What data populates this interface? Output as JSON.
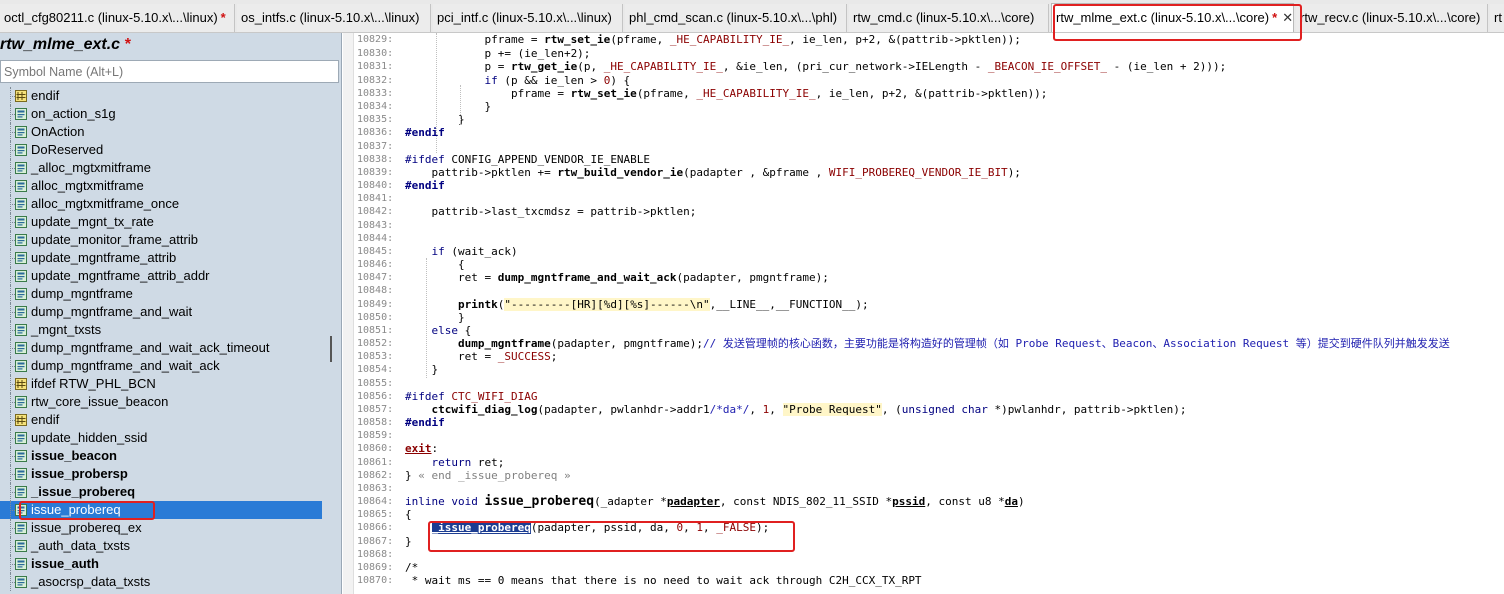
{
  "tabs": [
    {
      "label": "octl_cfg80211.c (linux-5.10.x\\...\\linux)",
      "modified": true,
      "active": false
    },
    {
      "label": "os_intfs.c (linux-5.10.x\\...\\linux)",
      "modified": false,
      "active": false
    },
    {
      "label": "pci_intf.c (linux-5.10.x\\...\\linux)",
      "modified": false,
      "active": false
    },
    {
      "label": "phl_cmd_scan.c (linux-5.10.x\\...\\phl)",
      "modified": false,
      "active": false
    },
    {
      "label": "rtw_cmd.c (linux-5.10.x\\...\\core)",
      "modified": false,
      "active": false
    },
    {
      "label": "rtw_mlme_ext.c (linux-5.10.x\\...\\core)",
      "modified": true,
      "active": true
    },
    {
      "label": "rtw_recv.c (linux-5.10.x\\...\\core)",
      "modified": false,
      "active": false
    },
    {
      "label": "rt",
      "modified": false,
      "active": false
    }
  ],
  "tab_modified_marker": "*",
  "tab_close_glyph": "✕",
  "left": {
    "file_title": "rtw_mlme_ext.c",
    "file_modified": "*",
    "search_placeholder": "Symbol Name (Alt+L)",
    "symbols": [
      {
        "name": "endif",
        "kind": "pp",
        "bold": false
      },
      {
        "name": "on_action_s1g",
        "kind": "func",
        "bold": false
      },
      {
        "name": "OnAction",
        "kind": "func",
        "bold": false
      },
      {
        "name": "DoReserved",
        "kind": "func",
        "bold": false
      },
      {
        "name": "_alloc_mgtxmitframe",
        "kind": "func",
        "bold": false
      },
      {
        "name": "alloc_mgtxmitframe",
        "kind": "func",
        "bold": false
      },
      {
        "name": "alloc_mgtxmitframe_once",
        "kind": "func",
        "bold": false
      },
      {
        "name": "update_mgnt_tx_rate",
        "kind": "func",
        "bold": false
      },
      {
        "name": "update_monitor_frame_attrib",
        "kind": "func",
        "bold": false
      },
      {
        "name": "update_mgntframe_attrib",
        "kind": "func",
        "bold": false
      },
      {
        "name": "update_mgntframe_attrib_addr",
        "kind": "func",
        "bold": false
      },
      {
        "name": "dump_mgntframe",
        "kind": "func",
        "bold": false
      },
      {
        "name": "dump_mgntframe_and_wait",
        "kind": "func",
        "bold": false
      },
      {
        "name": "_mgnt_txsts",
        "kind": "func",
        "bold": false
      },
      {
        "name": "dump_mgntframe_and_wait_ack_timeout",
        "kind": "func",
        "bold": false
      },
      {
        "name": "dump_mgntframe_and_wait_ack",
        "kind": "func",
        "bold": false
      },
      {
        "name": "ifdef RTW_PHL_BCN",
        "kind": "pp",
        "bold": false
      },
      {
        "name": "rtw_core_issue_beacon",
        "kind": "func",
        "bold": false
      },
      {
        "name": "endif",
        "kind": "pp",
        "bold": false
      },
      {
        "name": "update_hidden_ssid",
        "kind": "func",
        "bold": false
      },
      {
        "name": "issue_beacon",
        "kind": "func",
        "bold": true
      },
      {
        "name": "issue_probersp",
        "kind": "func",
        "bold": true
      },
      {
        "name": "_issue_probereq",
        "kind": "func",
        "bold": true
      },
      {
        "name": "issue_probereq",
        "kind": "func",
        "bold": false,
        "selected": true
      },
      {
        "name": "issue_probereq_ex",
        "kind": "func",
        "bold": false
      },
      {
        "name": "_auth_data_txsts",
        "kind": "func",
        "bold": false
      },
      {
        "name": "issue_auth",
        "kind": "func",
        "bold": true
      },
      {
        "name": "_asocrsp_data_txsts",
        "kind": "func",
        "bold": false
      }
    ]
  },
  "editor": {
    "line_numbers": [
      "10829:",
      "10830:",
      "10831:",
      "10832:",
      "10833:",
      "10834:",
      "10835:",
      "10836:",
      "10837:",
      "10838:",
      "10839:",
      "10840:",
      "10841:",
      "10842:",
      "10843:",
      "10844:",
      "10845:",
      "10846:",
      "10847:",
      "10848:",
      "10849:",
      "10850:",
      "10851:",
      "10852:",
      "10853:",
      "10854:",
      "10855:",
      "10856:",
      "10857:",
      "10858:",
      "10859:",
      "10860:",
      "10861:",
      "10862:",
      "10863:",
      "10864:",
      "10865:",
      "10866:",
      "10867:",
      "10868:",
      "10869:",
      "10870:"
    ],
    "code": {
      "l0_pre": "            pframe = ",
      "l0_fn": "rtw_set_ie",
      "l0_a": "(pframe, ",
      "l0_m": "_HE_CAPABILITY_IE_",
      "l0_b": ", ie_len, p+2, &(pattrib->pktlen));",
      "l1": "            p += (ie_len+2);",
      "l2_pre": "            p = ",
      "l2_fn": "rtw_get_ie",
      "l2_a": "(p, ",
      "l2_m": "_HE_CAPABILITY_IE_",
      "l2_b": ", &ie_len, (pri_cur_network->IELength - ",
      "l2_m2": "_BEACON_IE_OFFSET_",
      "l2_c": " - (ie_len + 2)));",
      "l3_kw": "            if",
      "l3_a": " (p && ie_len > ",
      "l3_n": "0",
      "l3_b": ") {",
      "l4_pre": "                pframe = ",
      "l4_fn": "rtw_set_ie",
      "l4_a": "(pframe, ",
      "l4_m": "_HE_CAPABILITY_IE_",
      "l4_b": ", ie_len, p+2, &(pattrib->pktlen));",
      "l5": "            }",
      "l6": "        }",
      "l7": "#endif",
      "l8": "",
      "l9_pp": "#ifdef",
      "l9_a": " CONFIG_APPEND_VENDOR_IE_ENABLE",
      "l10_pre": "    pattrib->pktlen += ",
      "l10_fn": "rtw_build_vendor_ie",
      "l10_a": "(padapter , &pframe , ",
      "l10_m": "WIFI_PROBEREQ_VENDOR_IE_BIT",
      "l10_b": ");",
      "l11": "#endif",
      "l12": "",
      "l13": "    pattrib->last_txcmdsz = pattrib->pktlen;",
      "l14": "",
      "l15": "",
      "l16_kw": "    if",
      "l16_a": " (wait_ack)",
      "l17": "        {",
      "l18_pre": "        ret = ",
      "l18_fn": "dump_mgntframe_and_wait_ack",
      "l18_a": "(padapter, pmgntframe);",
      "l19": "",
      "l20_pre": "        ",
      "l20_fn": "printk",
      "l20_a": "(",
      "l20_s": "\"---------[HR][%d][%s]------\\n\"",
      "l20_b": ",__LINE__,__FUNCTION__);",
      "l21": "        }",
      "l22_kw": "    else",
      "l22_a": " {",
      "l23_pre": "        ",
      "l23_fn": "dump_mgntframe",
      "l23_a": "(padapter, pmgntframe);",
      "l23_c": "// 发送管理帧的核心函数，主要功能是将构造好的管理帧（如 Probe Request、Beacon、Association Request 等）提交到硬件队列并触发发送",
      "l24_pre": "        ret = ",
      "l24_m": "_SUCCESS",
      "l24_b": ";",
      "l25": "    }",
      "l26": "",
      "l27_pp": "#ifdef",
      "l27_m": " CTC_WIFI_DIAG",
      "l28_pre": "    ",
      "l28_fn": "ctcwifi_diag_log",
      "l28_a": "(padapter, pwlanhdr->addr1",
      "l28_c": "/*da*/",
      "l28_b": ", ",
      "l28_n": "1",
      "l28_b2": ", ",
      "l28_s": "\"Probe Request\"",
      "l28_b3": ", (",
      "l28_kw": "unsigned char",
      "l28_b4": " *)pwlanhdr, pattrib->pktlen);",
      "l29": "#endif",
      "l30": "",
      "l31_lbl": "exit",
      "l31_a": ":",
      "l32_kw": "    return",
      "l32_a": " ret;",
      "l33_a": "} ",
      "l33_c": "« end _issue_probereq »",
      "l34": "",
      "l35_kw": "inline void ",
      "l35_fn": "issue_probereq",
      "l35_a": "(_adapter *",
      "l35_p1": "padapter",
      "l35_b": ", const NDIS_802_11_SSID *",
      "l35_p2": "pssid",
      "l35_c": ", const u8 *",
      "l35_p3": "da",
      "l35_d": ")",
      "l36": "{",
      "l37_pre": "    ",
      "l37_sel": "_issue_probereq",
      "l37_a": "(padapter, pssid, da, ",
      "l37_n1": "0",
      "l37_b": ", ",
      "l37_n2": "1",
      "l37_c": ", ",
      "l37_m": "_FALSE",
      "l37_d": ");",
      "l38": "}",
      "l39": "",
      "l40": "/*",
      "l41": " * wait ms == 0 means that there is no need to wait ack through C2H_CCX_TX_RPT"
    }
  }
}
